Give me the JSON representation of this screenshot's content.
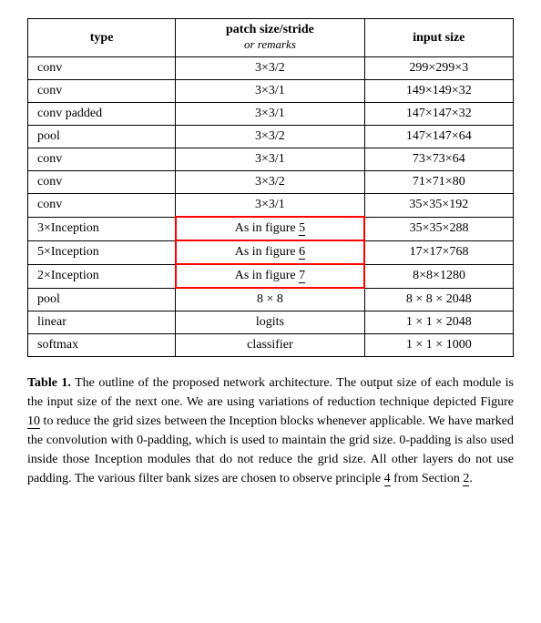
{
  "table": {
    "headers": {
      "col1": "type",
      "col2_main": "patch size/stride",
      "col2_sub": "or remarks",
      "col3": "input size"
    },
    "rows": [
      {
        "type": "conv",
        "patch": "3×3/2",
        "input": "299×299×3"
      },
      {
        "type": "conv",
        "patch": "3×3/1",
        "input": "149×149×32"
      },
      {
        "type": "conv padded",
        "patch": "3×3/1",
        "input": "147×147×32"
      },
      {
        "type": "pool",
        "patch": "3×3/2",
        "input": "147×147×64"
      },
      {
        "type": "conv",
        "patch": "3×3/1",
        "input": "73×73×64"
      },
      {
        "type": "conv",
        "patch": "3×3/2",
        "input": "71×71×80"
      },
      {
        "type": "conv",
        "patch": "3×3/1",
        "input": "35×35×192"
      },
      {
        "type": "3×Inception",
        "patch": "As in figure 5",
        "input": "35×35×288",
        "highlighted": true
      },
      {
        "type": "5×Inception",
        "patch": "As in figure 6",
        "input": "17×17×768",
        "highlighted": true
      },
      {
        "type": "2×Inception",
        "patch": "As in figure 7",
        "input": "8×8×1280",
        "highlighted": true
      },
      {
        "type": "pool",
        "patch": "8 × 8",
        "input": "8 × 8 × 2048"
      },
      {
        "type": "linear",
        "patch": "logits",
        "input": "1 × 1 × 2048"
      },
      {
        "type": "softmax",
        "patch": "classifier",
        "input": "1 × 1 × 1000"
      }
    ]
  },
  "caption": {
    "label": "Table 1.",
    "text": " The outline of the proposed network architecture.  The output size of each module is the input size of the next one.  We are using variations of reduction technique depicted Figure ",
    "link1": "10",
    "text2": " to reduce the grid sizes between the Inception blocks whenever applicable.  We have marked the convolution with 0-padding, which is used to maintain the grid size.  0-padding is also used inside those Inception modules that do not reduce the grid size.  All other layers do not use padding.  The various filter bank sizes are chosen to observe principle ",
    "link2": "4",
    "text3": " from Section ",
    "link3": "2",
    "text4": "."
  }
}
